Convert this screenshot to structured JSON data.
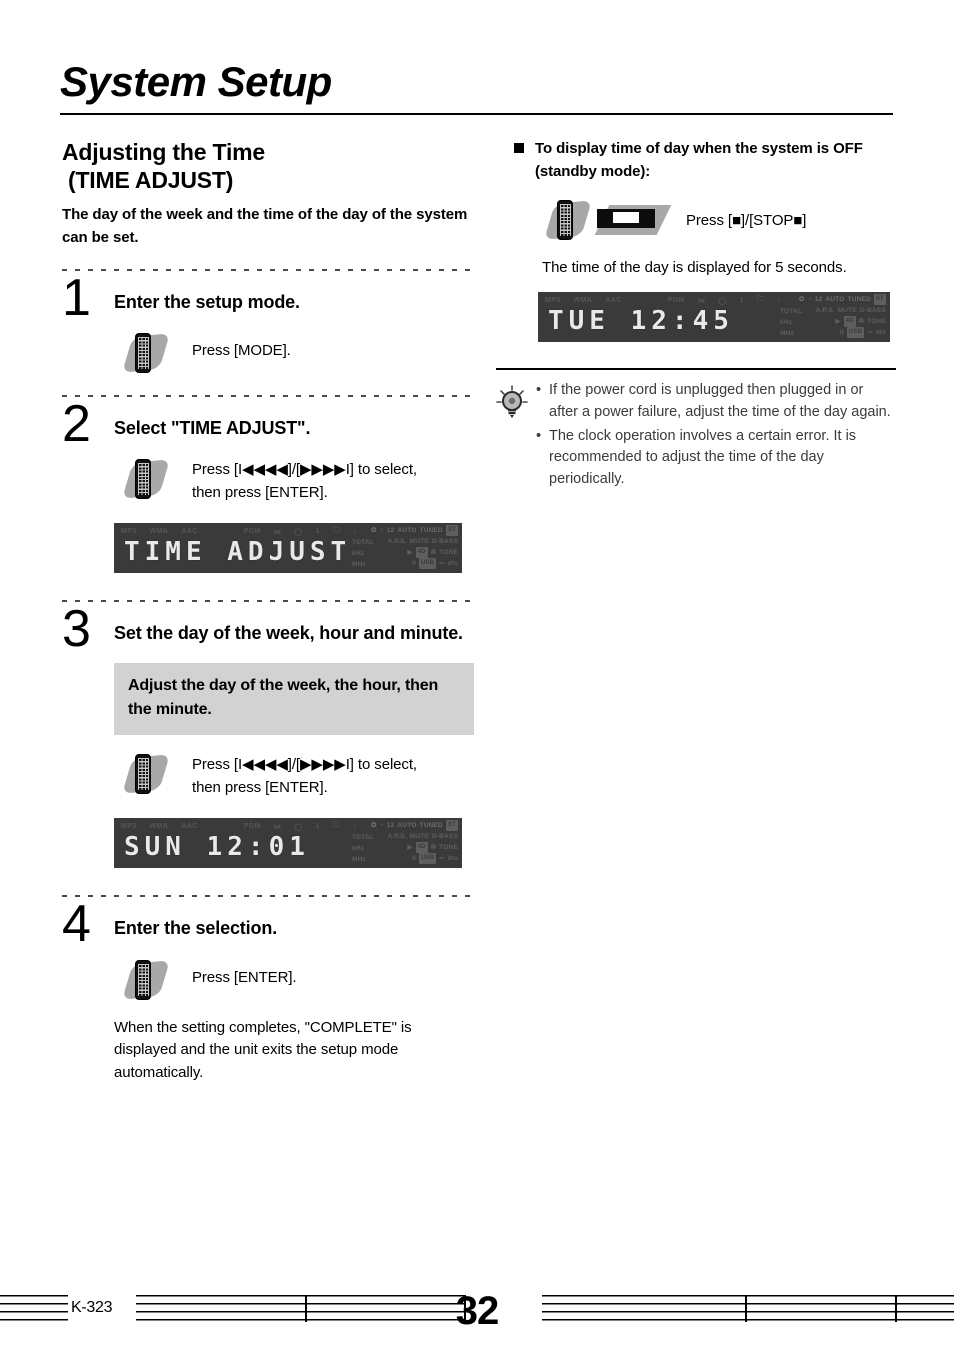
{
  "header": {
    "chapter_title": "System Setup"
  },
  "left": {
    "section_title_line1": "Adjusting the Time",
    "section_title_line2": "(TIME ADJUST)",
    "section_intro": "The day of the week and the time of the day of the system can be set.",
    "steps": [
      {
        "number": "1",
        "heading": "Enter the setup mode.",
        "action_text": "Press [MODE]."
      },
      {
        "number": "2",
        "heading": "Select \"TIME ADJUST\".",
        "action_text": "Press [I◀◀◀◀]/[▶▶▶▶I] to select,\nthen press [ENTER]."
      },
      {
        "number": "3",
        "heading": "Set the day of the week, hour and minute.",
        "callout": "Adjust the day of the week, the hour, then the minute.",
        "action_text": "Press [I◀◀◀◀]/[▶▶▶▶I] to select,\nthen press [ENTER]."
      },
      {
        "number": "4",
        "heading": "Enter the selection.",
        "action_text": "Press [ENTER].",
        "note": "When the setting completes, \"COMPLETE\" is displayed and the unit exits the setup mode automatically."
      }
    ],
    "lcd_time_adjust": "TIME ADJUST",
    "lcd_sun": "SUN 12:01"
  },
  "right": {
    "section_heading": "To display time of day when the system is OFF (standby mode):",
    "press_text": "Press [■]/[STOP■]",
    "note": "The time of the day is displayed for 5 seconds.",
    "lcd_tue": "TUE 12:45",
    "tips": [
      "If the power cord is unplugged then plugged in or after a power failure, adjust the time of the day again.",
      "The clock operation involves a certain error. It is recommended to adjust the time of the day periodically."
    ]
  },
  "lcd_indicators": {
    "top_left": [
      "MP3",
      "WMA",
      "AAC"
    ],
    "top_mid": [
      "PGM",
      "⋈",
      "◯",
      "1",
      "🗀",
      "♪"
    ],
    "right_row1": [
      "12",
      "AUTO",
      "TUNED",
      "ST"
    ],
    "right_row2": [
      "A.P.S.",
      "MUTE",
      "D-BASS"
    ],
    "right_row3": [
      "TOTAL",
      "▶",
      "4D",
      "TONE"
    ],
    "right_row4": [
      "kHz",
      "MHz",
      "II",
      "USB",
      "dts"
    ],
    "left_stack": [
      "TOTAL",
      "kHz",
      "MHz"
    ]
  },
  "footer": {
    "model": "K-323",
    "page_number": "32"
  },
  "colors": {
    "lcd_background": "#3a3a3a",
    "lcd_text": "#e9e9e9",
    "lcd_indicator": "#5e5e5e",
    "callout_background": "#d2d2d2"
  }
}
